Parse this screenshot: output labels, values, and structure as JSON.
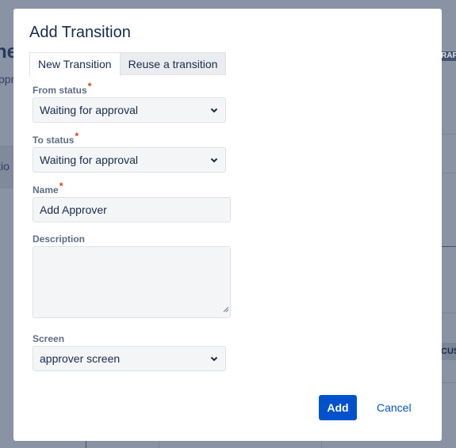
{
  "background": {
    "title_fragment": "ne",
    "subtitle_fragment": "ppr",
    "row_fragment": "itio",
    "lozenge_right": "RAF",
    "lozenge_right_2": "CUS"
  },
  "dialog": {
    "title": "Add Transition",
    "tabs": [
      {
        "label": "New Transition",
        "active": true
      },
      {
        "label": "Reuse a transition",
        "active": false
      }
    ],
    "fields": {
      "from_status": {
        "label": "From status",
        "required_marker": "*",
        "value": "Waiting for approval"
      },
      "to_status": {
        "label": "To status",
        "required_marker": "*",
        "value": "Waiting for approval"
      },
      "name": {
        "label": "Name",
        "required_marker": "*",
        "value": "Add Approver"
      },
      "description": {
        "label": "Description",
        "value": ""
      },
      "screen": {
        "label": "Screen",
        "value": "approver screen"
      }
    },
    "buttons": {
      "add": "Add",
      "cancel": "Cancel"
    }
  },
  "colors": {
    "primary": "#0052cc",
    "required": "#de350b",
    "text": "#172b4d",
    "label": "#5e6c84",
    "overlay": "#8993a4"
  }
}
